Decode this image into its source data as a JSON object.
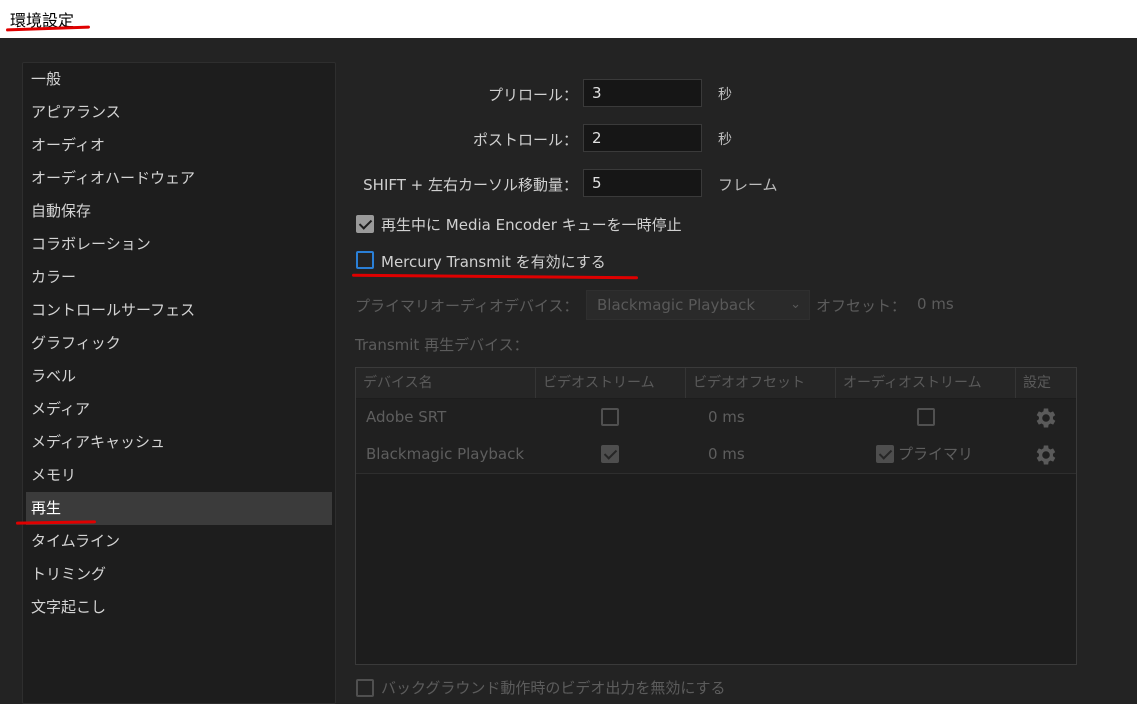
{
  "window": {
    "title": "環境設定"
  },
  "colors": {
    "background": "#232323",
    "accent_focus": "#2a7fd6",
    "annotation_red": "#e00000",
    "selected_item": "#3b3b3b"
  },
  "sidebar": {
    "items": [
      {
        "label": "一般"
      },
      {
        "label": "アピアランス"
      },
      {
        "label": "オーディオ"
      },
      {
        "label": "オーディオハードウェア"
      },
      {
        "label": "自動保存"
      },
      {
        "label": "コラボレーション"
      },
      {
        "label": "カラー"
      },
      {
        "label": "コントロールサーフェス"
      },
      {
        "label": "グラフィック"
      },
      {
        "label": "ラベル"
      },
      {
        "label": "メディア"
      },
      {
        "label": "メディアキャッシュ"
      },
      {
        "label": "メモリ"
      },
      {
        "label": "再生",
        "selected": true
      },
      {
        "label": "タイムライン"
      },
      {
        "label": "トリミング"
      },
      {
        "label": "文字起こし"
      }
    ]
  },
  "playback": {
    "preroll": {
      "label": "プリロール：",
      "value": "3",
      "unit": "秒"
    },
    "postroll": {
      "label": "ポストロール：",
      "value": "2",
      "unit": "秒"
    },
    "shift_move": {
      "label": "SHIFT + 左右カーソル移動量：",
      "value": "5",
      "unit": "フレーム"
    },
    "pause_media_encoder": {
      "label": "再生中に Media Encoder キューを一時停止",
      "checked": true
    },
    "mercury_transmit": {
      "label": "Mercury Transmit を有効にする",
      "checked": false
    },
    "primary_audio_device": {
      "label": "プライマリオーディオデバイス：",
      "value": "Blackmagic Playback"
    },
    "offset": {
      "label": "オフセット：",
      "value": "0 ms"
    },
    "transmit_devices_label": "Transmit 再生デバイス：",
    "table": {
      "columns": [
        "デバイス名",
        "ビデオストリーム",
        "ビデオオフセット",
        "オーディオストリーム",
        "設定"
      ],
      "rows": [
        {
          "name": "Adobe SRT",
          "video_stream": false,
          "video_offset": "0 ms",
          "audio_stream": false,
          "audio_label": ""
        },
        {
          "name": "Blackmagic Playback",
          "video_stream": true,
          "video_offset": "0 ms",
          "audio_stream": true,
          "audio_label": "プライマリ"
        }
      ],
      "settings_icon": "gear-icon"
    },
    "disable_background_output": {
      "label": "バックグラウンド動作時のビデオ出力を無効にする",
      "checked": false
    }
  }
}
